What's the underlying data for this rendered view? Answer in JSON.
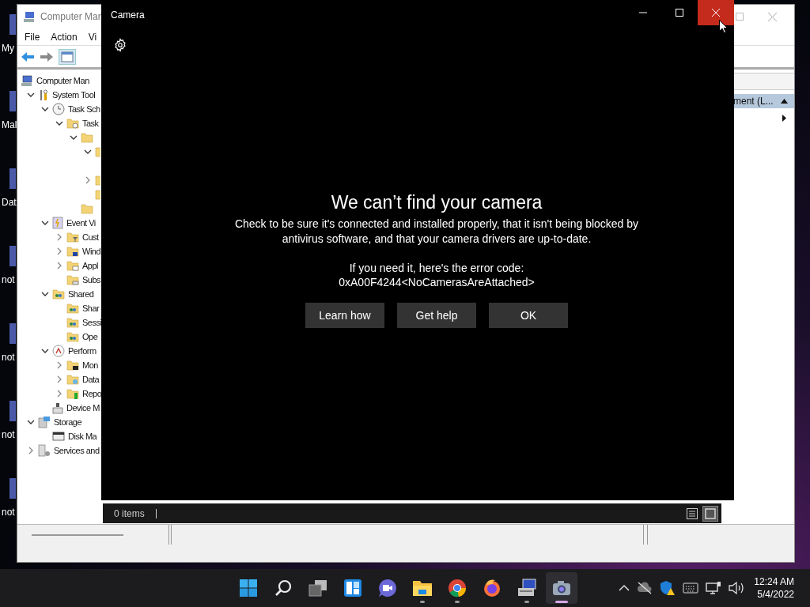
{
  "desktop_icons": [
    {
      "label": "My"
    },
    {
      "label": "Mal"
    },
    {
      "label": "Dat"
    },
    {
      "label": "not"
    },
    {
      "label": "not"
    },
    {
      "label": "not"
    },
    {
      "label": "not"
    }
  ],
  "mmc": {
    "title": "Computer Man",
    "menu": [
      "File",
      "Action",
      "Vi"
    ],
    "toolbar": [
      {
        "kind": "back",
        "disabled": false
      },
      {
        "kind": "forward",
        "disabled": true
      },
      {
        "kind": "tree-toggle",
        "disabled": false
      }
    ],
    "tree": [
      {
        "label": "Computer Man",
        "kind": "computer",
        "children": [
          {
            "label": "System Tool",
            "kind": "tools",
            "expanded": true,
            "children": [
              {
                "label": "Task Sch",
                "kind": "clock",
                "expanded": true,
                "children": [
                  {
                    "label": "Task",
                    "kind": "folder-clock",
                    "expanded": true,
                    "children": [
                      {
                        "kind": "folder",
                        "expanded": true,
                        "children": [
                          {
                            "kind": "folder",
                            "expanded": true
                          },
                          {
                            "kind": "folder",
                            "expanded": false
                          },
                          {
                            "kind": "folder"
                          }
                        ]
                      },
                      {
                        "kind": "folder"
                      }
                    ]
                  }
                ]
              },
              {
                "label": "Event Vi",
                "kind": "event",
                "expanded": true,
                "children": [
                  {
                    "label": "Cust",
                    "kind": "folder-filter",
                    "expanded": false
                  },
                  {
                    "label": "Wind",
                    "kind": "folder-windows",
                    "expanded": false
                  },
                  {
                    "label": "Appl",
                    "kind": "folder-window",
                    "expanded": false
                  },
                  {
                    "label": "Subs",
                    "kind": "folder-sub"
                  }
                ]
              },
              {
                "label": "Shared",
                "kind": "shared",
                "expanded": true,
                "children": [
                  {
                    "label": "Shar",
                    "kind": "shared"
                  },
                  {
                    "label": "Sessi",
                    "kind": "shared"
                  },
                  {
                    "label": "Ope",
                    "kind": "shared"
                  }
                ]
              },
              {
                "label": "Perform",
                "kind": "perf",
                "expanded": true,
                "children": [
                  {
                    "label": "Mon",
                    "kind": "folder-monitor",
                    "expanded": false
                  },
                  {
                    "label": "Data",
                    "kind": "folder-data",
                    "expanded": false
                  },
                  {
                    "label": "Repo",
                    "kind": "folder-report",
                    "expanded": false
                  }
                ]
              },
              {
                "label": "Device M",
                "kind": "device"
              }
            ]
          },
          {
            "label": "Storage",
            "kind": "storage",
            "expanded": true,
            "children": [
              {
                "label": "Disk Ma",
                "kind": "disk"
              }
            ]
          },
          {
            "label": "Services and",
            "kind": "services",
            "expanded": false
          }
        ]
      }
    ],
    "actions_header": "ment (L..."
  },
  "camera": {
    "title": "Camera",
    "controls": [
      {
        "kind": "minimize",
        "hovered": false
      },
      {
        "kind": "maximize",
        "hovered": false
      },
      {
        "kind": "close",
        "hovered": true
      }
    ],
    "heading": "We can’t find your camera",
    "message": "Check to be sure it's connected and installed properly, that it isn't being blocked by antivirus software, and that your camera drivers are up-to-date.",
    "error_intro": "If you need it, here's the error code:",
    "error_code": "0xA00F4244<NoCamerasAreAttached>",
    "buttons": [
      "Learn how",
      "Get help",
      "OK"
    ]
  },
  "explorer_status": {
    "count": "0 items",
    "views": [
      {
        "kind": "details",
        "selected": false
      },
      {
        "kind": "large-icons",
        "selected": true
      }
    ]
  },
  "taskbar": {
    "apps": [
      {
        "kind": "start",
        "running": false,
        "active": false
      },
      {
        "kind": "search",
        "running": false,
        "active": false
      },
      {
        "kind": "task-view",
        "running": false,
        "active": false
      },
      {
        "kind": "widgets",
        "running": false,
        "active": false
      },
      {
        "kind": "chat",
        "running": false,
        "active": false
      },
      {
        "kind": "files",
        "running": true,
        "active": false
      },
      {
        "kind": "chrome",
        "running": true,
        "active": false
      },
      {
        "kind": "firefox",
        "running": false,
        "active": false
      },
      {
        "kind": "computer-management",
        "running": true,
        "active": false
      },
      {
        "kind": "camera",
        "running": true,
        "active": true
      }
    ],
    "tray": [
      {
        "kind": "chevron"
      },
      {
        "kind": "cloud"
      },
      {
        "kind": "shield"
      },
      {
        "kind": "keyboard"
      },
      {
        "kind": "network"
      },
      {
        "kind": "volume"
      }
    ],
    "time": "12:24 AM",
    "date": "5/4/2022"
  }
}
